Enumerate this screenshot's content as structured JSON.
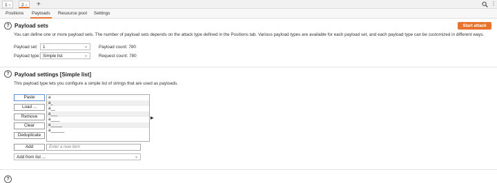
{
  "instance_tabs": [
    {
      "label": "1",
      "close": "×"
    },
    {
      "label": "2",
      "close": "×"
    }
  ],
  "new_tab_label": "+",
  "sub_tabs": [
    "Positions",
    "Payloads",
    "Resource pool",
    "Settings"
  ],
  "payload_sets": {
    "title": "Payload sets",
    "description": "You can define one or more payload sets. The number of payload sets depends on the attack type defined in the Positions tab. Various payload types are available for each payload set, and each payload type can be customized in different ways.",
    "start_attack": "Start attack",
    "payload_set_label": "Payload set:",
    "payload_set_value": "1",
    "payload_type_label": "Payload type:",
    "payload_type_value": "Simple list",
    "payload_count": "Payload count:  780",
    "request_count": "Request count:  780"
  },
  "payload_settings": {
    "title": "Payload settings [Simple list]",
    "description": "This payload type lets you configure a simple list of strings that are used as payloads.",
    "buttons": [
      "Paste",
      "Load ...",
      "Remove",
      "Clear",
      "Deduplicate"
    ],
    "list_items": [
      "a",
      "a_",
      "a__",
      "a___",
      "a____",
      "a_____",
      "a______"
    ],
    "add_label": "Add",
    "add_placeholder": "Enter a new item",
    "add_from_list": "Add from list ..."
  },
  "colors": {
    "accent": "#e8732c"
  }
}
